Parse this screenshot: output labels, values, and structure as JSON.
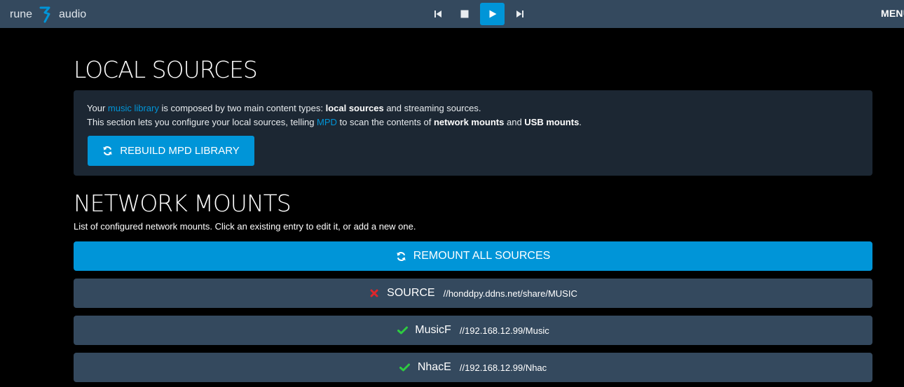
{
  "brand": {
    "left": "rune",
    "right": "audio"
  },
  "player": {
    "prev": "previous-icon",
    "stop": "stop-icon",
    "play": "play-icon",
    "next": "next-icon"
  },
  "menu_label": "MENU",
  "local": {
    "title": "LOCAL SOURCES",
    "line1_a": "Your ",
    "line1_link": "music library",
    "line1_b": " is composed by two main content types: ",
    "line1_bold": "local sources",
    "line1_c": " and streaming sources.",
    "line2_a": "This section lets you configure your local sources, telling ",
    "line2_link": "MPD",
    "line2_b": " to scan the contents of ",
    "line2_bold1": "network mounts",
    "line2_c": " and ",
    "line2_bold2": "USB mounts",
    "line2_d": ".",
    "rebuild_label": "REBUILD MPD LIBRARY"
  },
  "network": {
    "title": "NETWORK MOUNTS",
    "description": "List of configured network mounts. Click an existing entry to edit it, or add a new one.",
    "remount_label": "REMOUNT ALL SOURCES",
    "mounts": [
      {
        "name": "SOURCE",
        "path": "//honddpy.ddns.net/share/MUSIC",
        "status": "error"
      },
      {
        "name": "MusicF",
        "path": "//192.168.12.99/Music",
        "status": "ok"
      },
      {
        "name": "NhacE",
        "path": "//192.168.12.99/Nhac",
        "status": "ok"
      }
    ]
  },
  "colors": {
    "accent": "#0095d8",
    "bar": "#34495e",
    "panel": "#1c2733",
    "ok": "#2ecc40",
    "error": "#e0262b"
  }
}
